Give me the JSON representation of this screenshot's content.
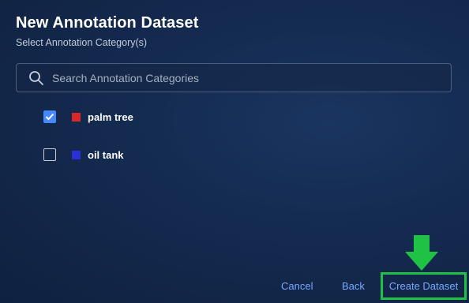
{
  "dialog": {
    "title": "New Annotation Dataset",
    "subtitle": "Select Annotation Category(s)"
  },
  "search": {
    "placeholder": "Search Annotation Categories",
    "value": "",
    "icon": "search-icon"
  },
  "categories": [
    {
      "label": "palm tree",
      "checked": true,
      "color": "#d8282a"
    },
    {
      "label": "oil tank",
      "checked": false,
      "color": "#2b2fd6"
    }
  ],
  "footer": {
    "cancel_label": "Cancel",
    "back_label": "Back",
    "create_label": "Create Dataset"
  },
  "colors": {
    "accent": "#4589ff",
    "link": "#78a9ff",
    "highlight": "#1fc244"
  }
}
